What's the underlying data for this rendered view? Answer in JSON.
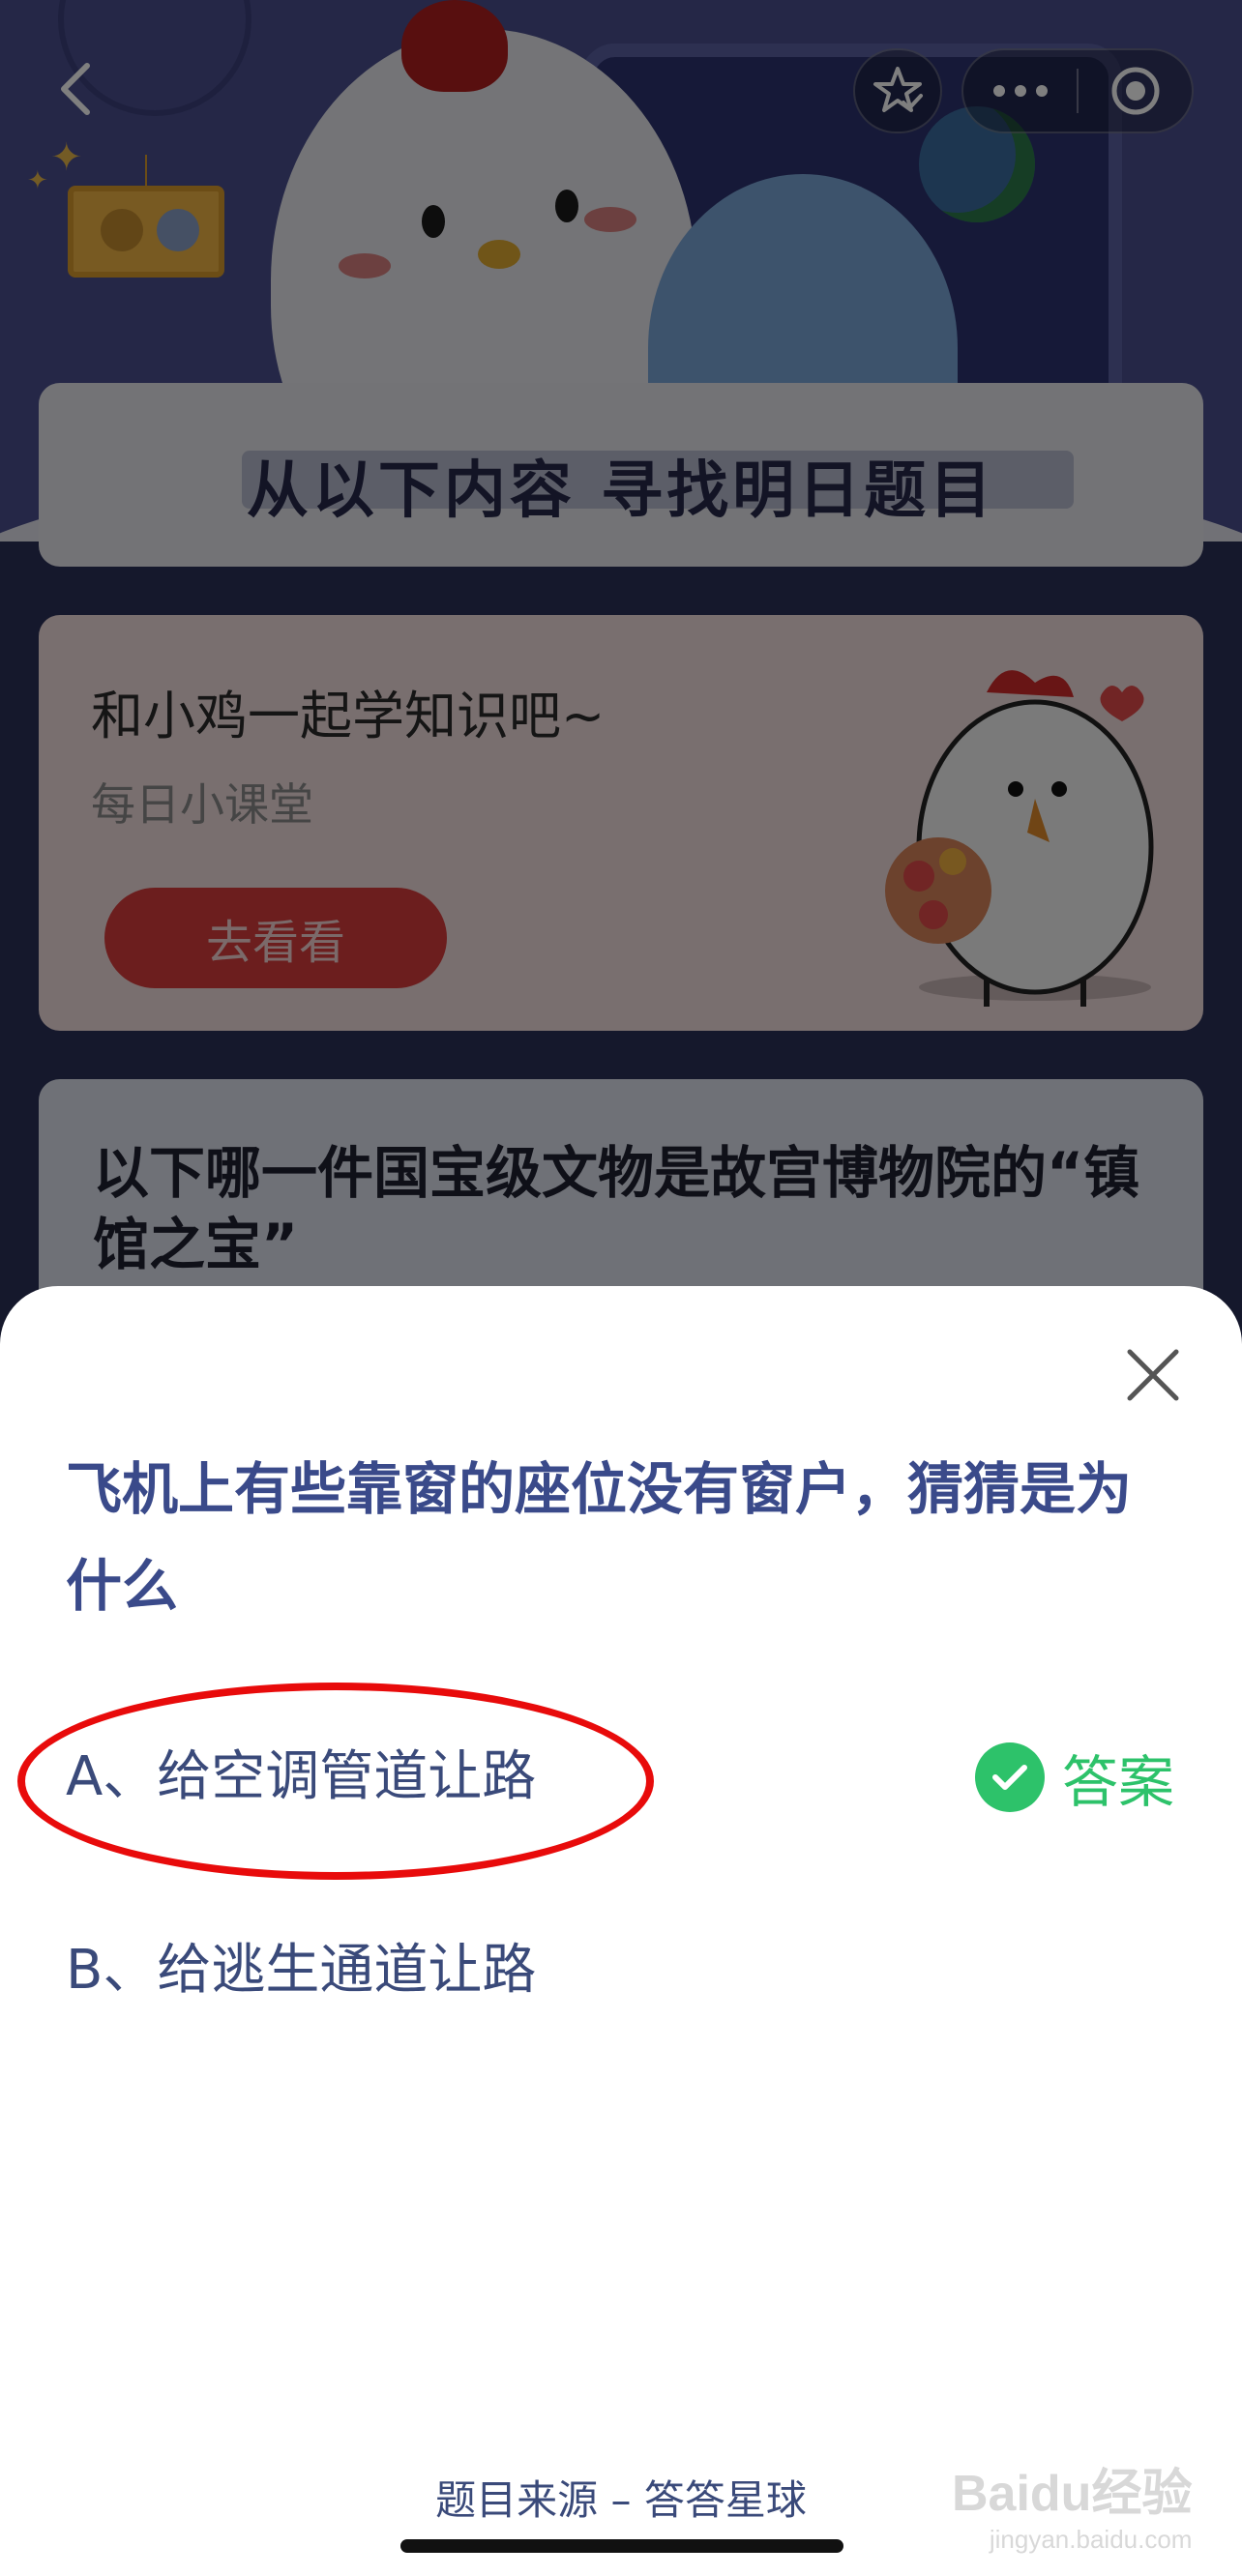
{
  "header": {
    "back_icon": "chevron-left-icon",
    "favorite_icon": "star-check-icon",
    "more_icon": "more-dots-icon",
    "close_app_icon": "target-circle-icon"
  },
  "find_card": {
    "title": "从以下内容 寻找明日题目"
  },
  "learn_card": {
    "title": "和小鸡一起学知识吧~",
    "subtitle": "每日小课堂",
    "button_label": "去看看"
  },
  "quiz_card": {
    "question": "以下哪一件国宝级文物是故宫博物院的“镇馆之宝”"
  },
  "sheet": {
    "close_icon": "close-icon",
    "question": "飞机上有些靠窗的座位没有窗户，猜猜是为什么",
    "options": [
      {
        "label": "A、给空调管道让路"
      },
      {
        "label": "B、给逃生通道让路"
      }
    ],
    "answer_label": "答案",
    "answer_icon": "check-circle-icon",
    "source": "题目来源 – 答答星球"
  },
  "watermark": {
    "brand": "Baidu经验",
    "url": "jingyan.baidu.com"
  },
  "colors": {
    "accent_blue": "#3a4a8a",
    "answer_green": "#2dc26a",
    "highlight_red": "#e80b0b",
    "button_red": "#d93d3d"
  }
}
